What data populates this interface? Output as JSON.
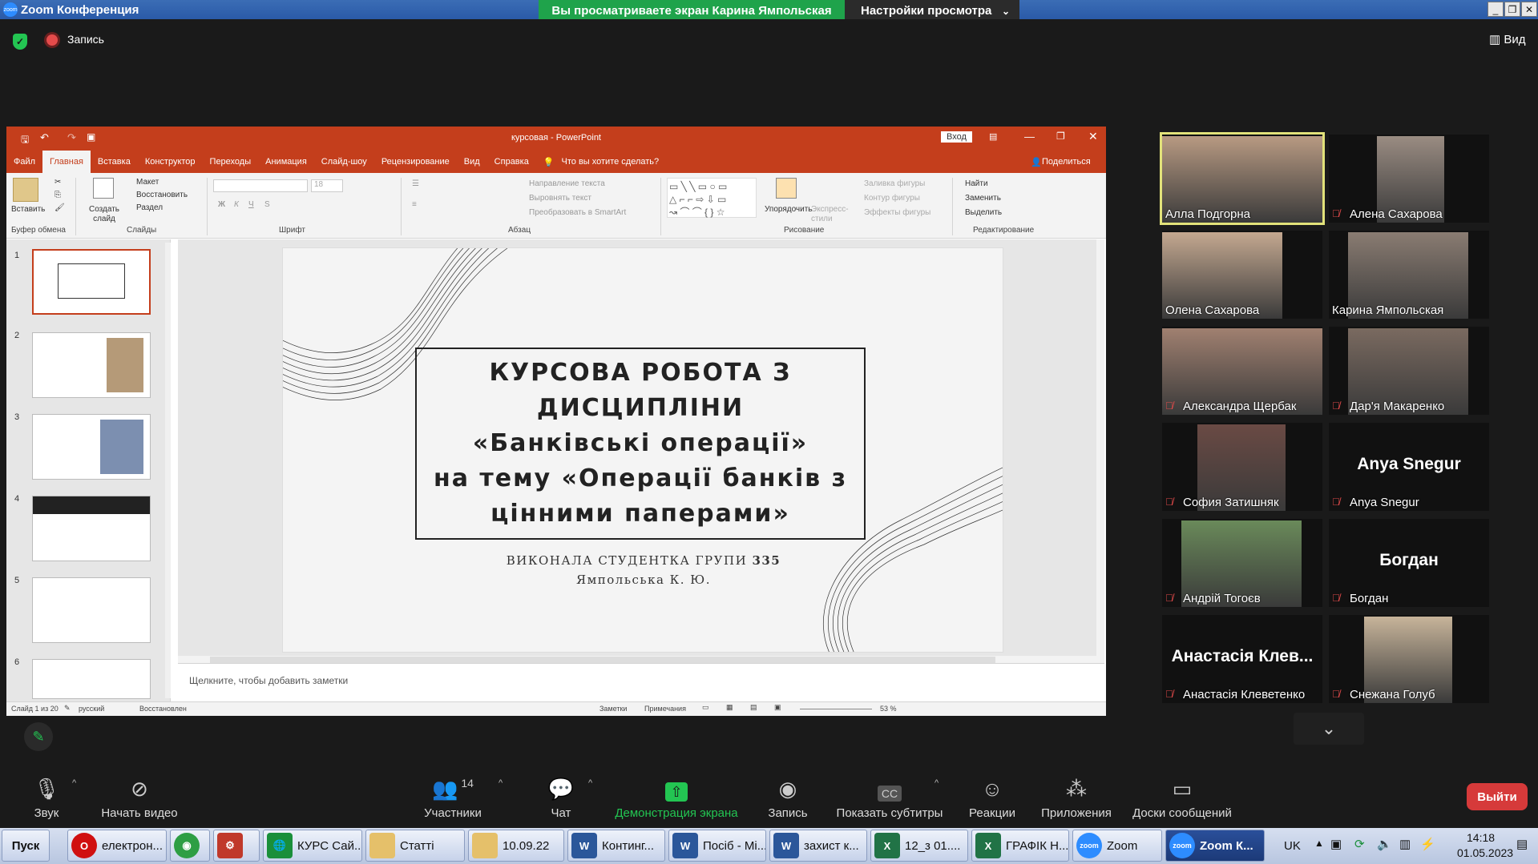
{
  "zoom": {
    "app_title": "Zoom Конференция",
    "share_banner": "Вы просматриваете экран Карина Ямпольская",
    "view_settings": "Настройки просмотра",
    "record_label": "Запись",
    "view_label": "Вид",
    "leave_label": "Выйти"
  },
  "ppt": {
    "file_title": "курсовая  -  PowerPoint",
    "signin": "Вход",
    "menu": [
      "Файл",
      "Главная",
      "Вставка",
      "Конструктор",
      "Переходы",
      "Анимация",
      "Слайд-шоу",
      "Рецензирование",
      "Вид",
      "Справка",
      "Что вы хотите сделать?"
    ],
    "share": "Поделиться",
    "ribbon": {
      "paste": "Вставить",
      "create_slide": "Создать слайд",
      "layout": "Макет",
      "reset": "Восстановить",
      "section": "Раздел",
      "text_direction": "Направление текста",
      "align_text": "Выровнять текст",
      "smartart": "Преобразовать в SmartArt",
      "arrange": "Упорядочить",
      "quick_styles": "Экспресс-стили",
      "shape_fill": "Заливка фигуры",
      "shape_outline": "Контур фигуры",
      "shape_effects": "Эффекты фигуры",
      "find": "Найти",
      "replace": "Заменить",
      "select": "Выделить",
      "font_size": "18",
      "groups": [
        "Буфер обмена",
        "Слайды",
        "Шрифт",
        "Абзац",
        "Рисование",
        "Редактирование"
      ]
    },
    "thumb_numbers": [
      "1",
      "2",
      "3",
      "4",
      "5",
      "6"
    ],
    "slide": {
      "title_lines": [
        "КУРСОВА РОБОТА З",
        "ДИСЦИПЛІНИ",
        "«Банківські операції»",
        "на тему «Операції банків з",
        "цінними паперами»"
      ],
      "subtitle_line1_a": "ВИКОНАЛА СТУДЕНТКА ГРУПИ",
      "subtitle_line1_b": "335",
      "subtitle_line2": "Ямпольська К. Ю."
    },
    "notes_placeholder": "Щелкните, чтобы добавить заметки",
    "status": {
      "slide": "Слайд 1 из 20",
      "lang": "русский",
      "state": "Восстановлен",
      "notes": "Заметки",
      "comments": "Примечания",
      "zoom": "53 %"
    }
  },
  "participants": [
    {
      "name": "Алла Подгорна",
      "muted": false,
      "video": true,
      "active": true
    },
    {
      "name": "Алена Сахарова",
      "muted": true,
      "video": true,
      "active": false
    },
    {
      "name": "Олена Сахарова",
      "muted": false,
      "video": true,
      "active": false
    },
    {
      "name": "Карина Ямпольская",
      "muted": false,
      "video": true,
      "active": false
    },
    {
      "name": "Александра Щербак",
      "muted": true,
      "video": true,
      "active": false
    },
    {
      "name": "Дар'я Макаренко",
      "muted": true,
      "video": true,
      "active": false
    },
    {
      "name": "София Затишняк",
      "muted": true,
      "video": true,
      "active": false
    },
    {
      "name": "Anya Snegur",
      "muted": true,
      "video": false,
      "big": "Anya Snegur",
      "active": false
    },
    {
      "name": "Андрій Тогоєв",
      "muted": true,
      "video": true,
      "active": false
    },
    {
      "name": "Богдан",
      "muted": true,
      "video": false,
      "big": "Богдан",
      "active": false
    },
    {
      "name": "Анастасія Клеветенко",
      "muted": true,
      "video": false,
      "big": "Анастасія Клев...",
      "active": false
    },
    {
      "name": "Снежана Голуб",
      "muted": true,
      "video": true,
      "active": false
    }
  ],
  "toolbar": {
    "audio": "Звук",
    "video": "Начать видео",
    "participants": "Участники",
    "participants_count": "14",
    "chat": "Чат",
    "share": "Демонстрация экрана",
    "record": "Запись",
    "captions": "Показать субтитры",
    "reactions": "Реакции",
    "apps": "Приложения",
    "whiteboards": "Доски сообщений"
  },
  "taskbar": {
    "start": "Пуск",
    "tasks": [
      "електрон...",
      "",
      "",
      "КУРС Сай...",
      "Статті",
      "10.09.22",
      "Континг...",
      "Посіб - Мі...",
      "захист к...",
      "12_з 01....",
      "ГРАФІК Н...",
      "Zoom",
      "Zoom К..."
    ],
    "lang": "UK",
    "time": "14:18",
    "date": "01.05.2023"
  },
  "colors": {
    "ppt_accent": "#c43e1c",
    "share_green": "#1fa34b",
    "leave_red": "#d63a3a"
  }
}
